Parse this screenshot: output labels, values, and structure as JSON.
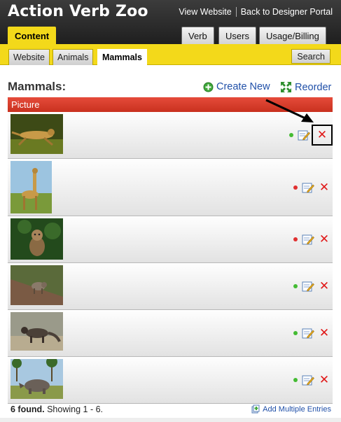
{
  "app": {
    "title": "Action Verb Zoo"
  },
  "top_links": {
    "view_website": "View Website",
    "back_to_portal": "Back to Designer Portal"
  },
  "main_tabs": [
    {
      "label": "Content",
      "active": true
    },
    {
      "label": "Verb",
      "active": false
    },
    {
      "label": "Users",
      "active": false
    },
    {
      "label": "Usage/Billing",
      "active": false
    }
  ],
  "sub_tabs": [
    {
      "label": "Website",
      "active": false
    },
    {
      "label": "Animals",
      "active": false
    },
    {
      "label": "Mammals",
      "active": true
    }
  ],
  "search_label": "Search",
  "section": {
    "title": "Mammals:",
    "create_new": "Create New",
    "reorder": "Reorder"
  },
  "column_header": "Picture",
  "rows": [
    {
      "animal_icon": "cheetah-photo",
      "status_color": "#44bb33"
    },
    {
      "animal_icon": "giraffe-photo",
      "status_color": "#e03030"
    },
    {
      "animal_icon": "monkey-photo",
      "status_color": "#e03030"
    },
    {
      "animal_icon": "hyena-photo",
      "status_color": "#44bb33"
    },
    {
      "animal_icon": "mongoose-photo",
      "status_color": "#44bb33"
    },
    {
      "animal_icon": "rhinoceros-photo",
      "status_color": "#44bb33"
    }
  ],
  "footer": {
    "found": "6 found.",
    "showing": "Showing 1 - 6.",
    "add_multiple": "Add Multiple Entries"
  },
  "colors": {
    "accent_yellow": "#f3d91a",
    "header_red": "#d63a28",
    "link_blue": "#1f4fa8",
    "delete_red": "#e01919"
  }
}
